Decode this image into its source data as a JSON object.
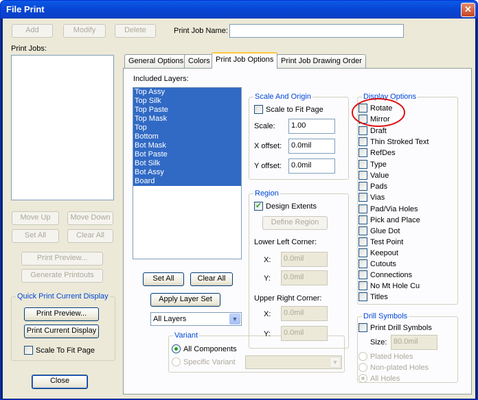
{
  "window": {
    "title": "File Print",
    "close_glyph": "✕"
  },
  "left": {
    "add": "Add",
    "modify": "Modify",
    "delete": "Delete",
    "print_job_name_label": "Print Job Name:",
    "print_job_name_value": "",
    "print_jobs_label": "Print Jobs:",
    "move_up": "Move Up",
    "move_down": "Move Down",
    "set_all": "Set All",
    "clear_all": "Clear All",
    "print_preview": "Print Preview...",
    "generate_printouts": "Generate Printouts",
    "quick_group": "Quick Print Current Display",
    "quick_preview": "Print Preview...",
    "quick_print": "Print Current Display",
    "scale_to_fit": "Scale To Fit Page",
    "close": "Close"
  },
  "tabs": [
    "General Options",
    "Colors",
    "Print Job Options",
    "Print Job Drawing Order"
  ],
  "layers": {
    "label": "Included Layers:",
    "items": [
      "Top Assy",
      "Top Silk",
      "Top Paste",
      "Top Mask",
      "Top",
      "Bottom",
      "Bot Mask",
      "Bot Paste",
      "Bot Silk",
      "Bot Assy",
      "Board"
    ],
    "set_all": "Set All",
    "clear_all": "Clear All",
    "apply": "Apply Layer Set",
    "combo": "All Layers"
  },
  "variant": {
    "title": "Variant",
    "all": "All Components",
    "specific": "Specific Variant",
    "combo": ""
  },
  "scale": {
    "title": "Scale And Origin",
    "fit": "Scale to Fit Page",
    "scale_label": "Scale:",
    "scale_value": "1.00",
    "xoff_label": "X offset:",
    "xoff_value": "0.0mil",
    "yoff_label": "Y offset:",
    "yoff_value": "0.0mil"
  },
  "region": {
    "title": "Region",
    "design_extents": "Design Extents",
    "define": "Define Region",
    "lower_left": "Lower Left Corner:",
    "upper_right": "Upper Right Corner:",
    "x_label": "X:",
    "y_label": "Y:",
    "ll_x": "0.0mil",
    "ll_y": "0.0mil",
    "ur_x": "0.0mil",
    "ur_y": "0.0mil"
  },
  "display": {
    "title": "Display Options",
    "items": [
      "Rotate",
      "Mirror",
      "Draft",
      "Thin Stroked Text",
      "RefDes",
      "Type",
      "Value",
      "Pads",
      "Vias",
      "Pad/Via Holes",
      "Pick and Place",
      "Glue Dot",
      "Test Point",
      "Keepout",
      "Cutouts",
      "Connections",
      "No Mt Hole Cu",
      "Titles"
    ]
  },
  "drill": {
    "title": "Drill Symbols",
    "print": "Print Drill Symbols",
    "size_label": "Size:",
    "size_value": "80.0mil",
    "plated": "Plated Holes",
    "nonplated": "Non-plated Holes",
    "all": "All Holes"
  },
  "colors": {
    "highlight_ring": "#e01010",
    "selection": "#316ac5",
    "group_title": "#0046d5"
  }
}
